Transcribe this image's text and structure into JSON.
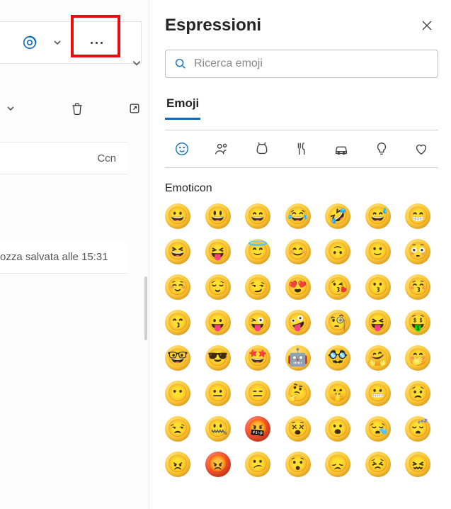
{
  "toolbar": {
    "loop_label": "Loop component",
    "more_label": "More options"
  },
  "compose": {
    "ccn_label": "Ccn",
    "draft_status": "ozza salvata alle 15:31"
  },
  "panel": {
    "title": "Espressioni",
    "search_placeholder": "Ricerca emoji",
    "tab_emoji": "Emoji",
    "section_emoticon": "Emoticon",
    "categories": [
      {
        "name": "smileys",
        "active": true
      },
      {
        "name": "people",
        "active": false
      },
      {
        "name": "animals",
        "active": false
      },
      {
        "name": "food",
        "active": false
      },
      {
        "name": "travel",
        "active": false
      },
      {
        "name": "objects",
        "active": false
      },
      {
        "name": "symbols",
        "active": false
      }
    ],
    "emojis": [
      {
        "g": "😀"
      },
      {
        "g": "😃"
      },
      {
        "g": "😄"
      },
      {
        "g": "😂"
      },
      {
        "g": "🤣"
      },
      {
        "g": "😅"
      },
      {
        "g": "😁"
      },
      {
        "g": "😆"
      },
      {
        "g": "😝"
      },
      {
        "g": "😇"
      },
      {
        "g": "😊"
      },
      {
        "g": "🙃"
      },
      {
        "g": "🙂"
      },
      {
        "g": "😳"
      },
      {
        "g": "☺️"
      },
      {
        "g": "😌"
      },
      {
        "g": "😏"
      },
      {
        "g": "😍"
      },
      {
        "g": "😘"
      },
      {
        "g": "😗"
      },
      {
        "g": "😚"
      },
      {
        "g": "😙"
      },
      {
        "g": "😛"
      },
      {
        "g": "😜"
      },
      {
        "g": "🤪"
      },
      {
        "g": "🧐"
      },
      {
        "g": "😝"
      },
      {
        "g": "🤑"
      },
      {
        "g": "🤓"
      },
      {
        "g": "😎"
      },
      {
        "g": "🤩"
      },
      {
        "g": "🤖"
      },
      {
        "g": "🥸"
      },
      {
        "g": "🤗"
      },
      {
        "g": "🤭"
      },
      {
        "g": "😶"
      },
      {
        "g": "😐"
      },
      {
        "g": "😑"
      },
      {
        "g": "🤔"
      },
      {
        "g": "🤫"
      },
      {
        "g": "😬"
      },
      {
        "g": "😟"
      },
      {
        "g": "😒"
      },
      {
        "g": "🤐"
      },
      {
        "g": "🤬",
        "red": true
      },
      {
        "g": "😵"
      },
      {
        "g": "😮"
      },
      {
        "g": "😪"
      },
      {
        "g": "😴"
      },
      {
        "g": "😠"
      },
      {
        "g": "😡",
        "red": true
      },
      {
        "g": "😕"
      },
      {
        "g": "😯"
      },
      {
        "g": "😞"
      },
      {
        "g": "😣"
      },
      {
        "g": "😖"
      }
    ]
  }
}
